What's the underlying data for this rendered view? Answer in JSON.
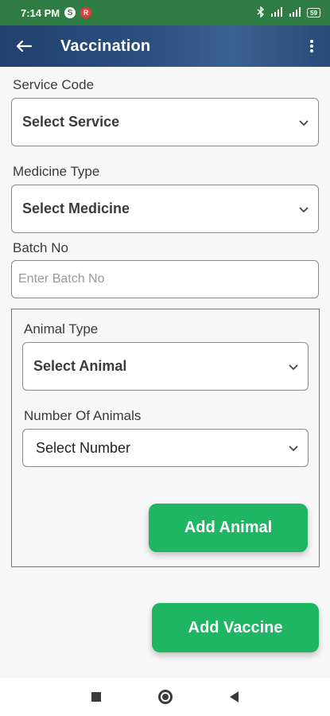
{
  "status_bar": {
    "time": "7:14 PM",
    "icon_s_letter": "S",
    "icon_r_letter": "R",
    "signal_1": "…ıl",
    "signal_2": "…ıl",
    "battery": "59"
  },
  "app_bar": {
    "title": "Vaccination",
    "back_icon": "←",
    "menu_icon": "⋮"
  },
  "form": {
    "service_code": {
      "label": "Service Code",
      "value": "Select Service"
    },
    "medicine_type": {
      "label": "Medicine Type",
      "value": "Select Medicine"
    },
    "batch_no": {
      "label": "Batch No",
      "placeholder": "Enter Batch No"
    },
    "animal_type": {
      "label": "Animal Type",
      "value": "Select Animal"
    },
    "number_of_animals": {
      "label": "Number Of Animals",
      "value": "Select Number"
    }
  },
  "buttons": {
    "add_animal": "Add Animal",
    "add_vaccine": "Add Vaccine"
  },
  "colors": {
    "status_bar": "#2f7d45",
    "app_bar": "#2c4f80",
    "button_green": "#1eb563"
  },
  "icons": [
    "arrow-left-icon",
    "kebab-menu-icon",
    "chevron-down-icon",
    "nav-recents-icon",
    "nav-home-icon",
    "nav-back-icon"
  ]
}
